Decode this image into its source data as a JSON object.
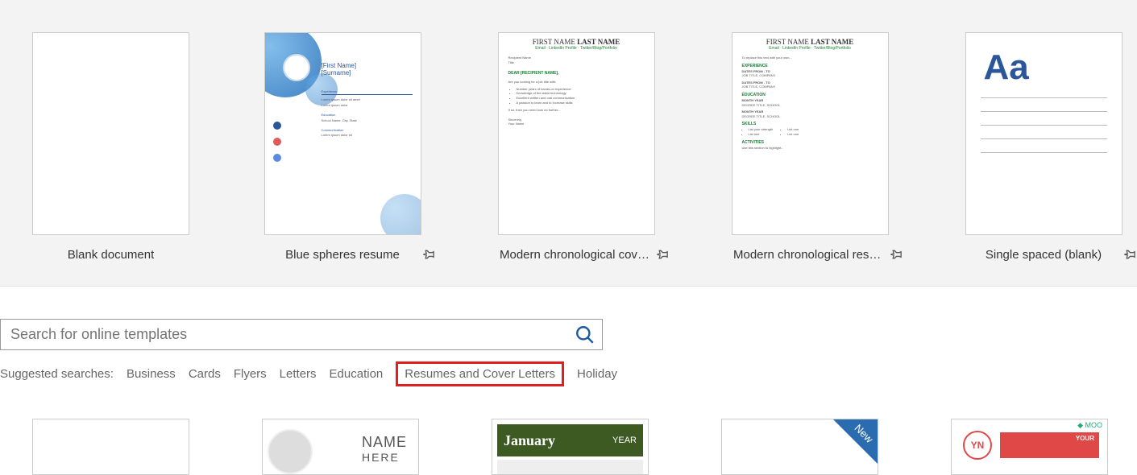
{
  "templates": [
    {
      "label": "Blank document",
      "pinnable": false
    },
    {
      "label": "Blue spheres resume",
      "pinnable": true
    },
    {
      "label": "Modern chronological cover...",
      "pinnable": true
    },
    {
      "label": "Modern chronological resume",
      "pinnable": true
    },
    {
      "label": "Single spaced (blank)",
      "pinnable": true
    }
  ],
  "search": {
    "placeholder": "Search for online templates"
  },
  "suggested": {
    "prefix": "Suggested searches:",
    "links": [
      "Business",
      "Cards",
      "Flyers",
      "Letters",
      "Education",
      "Resumes and Cover Letters",
      "Holiday"
    ],
    "highlighted": "Resumes and Cover Letters"
  },
  "thumb_text": {
    "resume_first": "FIRST NAME",
    "resume_last": "LAST NAME",
    "aa": "Aa",
    "blue_first": "[First Name]",
    "blue_surname": "[Surname]",
    "calendar_month": "January",
    "calendar_year": "YEAR",
    "new_badge": "New",
    "name_here_top": "NAME",
    "name_here_bottom": "HERE",
    "yn": "YN",
    "moo": "MOO",
    "your_text": "YOUR"
  },
  "resume_sections": {
    "experience": "EXPERIENCE",
    "education": "EDUCATION",
    "skills": "SKILLS",
    "activities": "ACTIVITIES"
  }
}
